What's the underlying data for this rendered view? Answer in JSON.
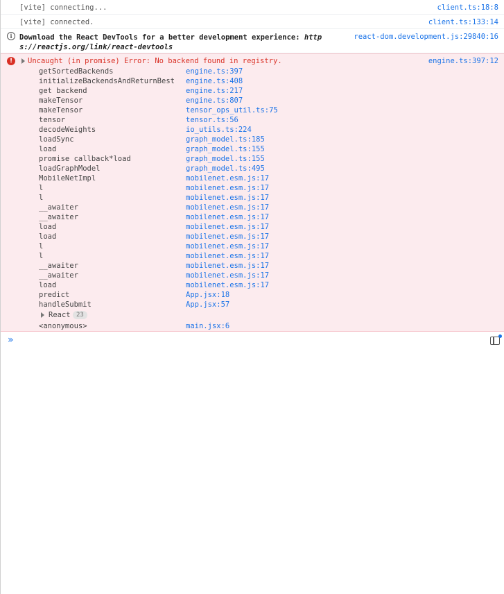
{
  "messages": [
    {
      "text": "[vite] connecting...",
      "source": "client.ts:18:8"
    },
    {
      "text": "[vite] connected.",
      "source": "client.ts:133:14"
    }
  ],
  "info": {
    "text_plain": "Download the React DevTools for a better development experience: ",
    "text_url": "https://reactjs.org/link/react-devtools",
    "source": "react-dom.development.js:29840:16"
  },
  "error": {
    "message": "Uncaught (in promise) Error: No backend found in registry.",
    "source": "engine.ts:397:12",
    "stack": [
      {
        "fn": "getSortedBackends",
        "loc": "engine.ts:397"
      },
      {
        "fn": "initializeBackendsAndReturnBest",
        "loc": "engine.ts:408"
      },
      {
        "fn": "get backend",
        "loc": "engine.ts:217"
      },
      {
        "fn": "makeTensor",
        "loc": "engine.ts:807"
      },
      {
        "fn": "makeTensor",
        "loc": "tensor_ops_util.ts:75"
      },
      {
        "fn": "tensor",
        "loc": "tensor.ts:56"
      },
      {
        "fn": "decodeWeights",
        "loc": "io_utils.ts:224"
      },
      {
        "fn": "loadSync",
        "loc": "graph_model.ts:185"
      },
      {
        "fn": "load",
        "loc": "graph_model.ts:155"
      },
      {
        "fn": "promise callback*load",
        "loc": "graph_model.ts:155"
      },
      {
        "fn": "loadGraphModel",
        "loc": "graph_model.ts:495"
      },
      {
        "fn": "MobileNetImpl",
        "loc": "mobilenet.esm.js:17"
      },
      {
        "fn": "l",
        "loc": "mobilenet.esm.js:17"
      },
      {
        "fn": "l",
        "loc": "mobilenet.esm.js:17"
      },
      {
        "fn": "__awaiter",
        "loc": "mobilenet.esm.js:17"
      },
      {
        "fn": "__awaiter",
        "loc": "mobilenet.esm.js:17"
      },
      {
        "fn": "load",
        "loc": "mobilenet.esm.js:17"
      },
      {
        "fn": "load",
        "loc": "mobilenet.esm.js:17"
      },
      {
        "fn": "l",
        "loc": "mobilenet.esm.js:17"
      },
      {
        "fn": "l",
        "loc": "mobilenet.esm.js:17"
      },
      {
        "fn": "__awaiter",
        "loc": "mobilenet.esm.js:17"
      },
      {
        "fn": "__awaiter",
        "loc": "mobilenet.esm.js:17"
      },
      {
        "fn": "load",
        "loc": "mobilenet.esm.js:17"
      },
      {
        "fn": "predict",
        "loc": "App.jsx:18"
      },
      {
        "fn": "handleSubmit",
        "loc": "App.jsx:57"
      }
    ],
    "react_group": {
      "label": "React",
      "count": "23"
    },
    "anonymous": {
      "fn": "<anonymous>",
      "loc": "main.jsx:6"
    }
  },
  "prompt": {
    "chevron": "»"
  },
  "colors": {
    "link": "#1a73e8",
    "error_text": "#d93025",
    "error_bg": "#fcebee",
    "error_border": "#f6c2c9"
  },
  "icons": {
    "info": "info-circle-icon",
    "error": "error-circle-icon",
    "expand": "expand-triangle-icon",
    "prompt": "console-prompt-chevron-icon",
    "sidebar": "show-console-sidebar-icon"
  }
}
